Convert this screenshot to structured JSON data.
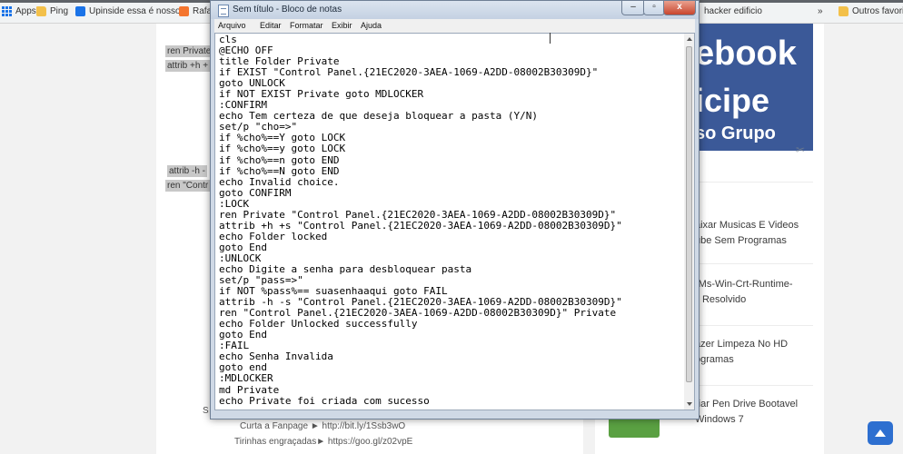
{
  "bookmarks_bar": {
    "items": [
      {
        "label": "Apps"
      },
      {
        "label": "Ping"
      },
      {
        "label": "Upinside essa é nosso"
      },
      {
        "label": "Rafa"
      },
      {
        "label": "hacker edificio"
      },
      {
        "label": "Outros favorit"
      }
    ],
    "more_label": "»"
  },
  "article": {
    "snippets": [
      "ren Private",
      "attrib +h +",
      "attrib -h -",
      "ren \"Contr"
    ],
    "bottom_links": [
      {
        "text": "Curta a Fanpage ► http://bit.ly/1Ssb3wO"
      },
      {
        "text": "Tirinhas engraçadas► https://goo.gl/z02vpE"
      }
    ],
    "left_fragment": "S"
  },
  "sidebar": {
    "banner": {
      "line1": "ebook",
      "line2": "icipe",
      "line3": "so Grupo"
    },
    "posts": [
      {
        "line1": "aixar Musicas E Videos",
        "line2": "ube Sem Programas"
      },
      {
        "line1": "-Ms-Win-Crt-Runtime-",
        "line2": "ll Resolvido"
      },
      {
        "line1": "azer Limpeza No HD",
        "line2": "ogramas"
      },
      {
        "line1": "riar Pen Drive Bootavel",
        "line2": "Windows 7"
      }
    ]
  },
  "notepad": {
    "title": "Sem título - Bloco de notas",
    "window_buttons": {
      "minimize": "–",
      "maximize": "▫",
      "close": "x"
    },
    "menu": [
      "Arquivo",
      "Editar",
      "Formatar",
      "Exibir",
      "Ajuda"
    ],
    "content": "cls\n@ECHO OFF\ntitle Folder Private\nif EXIST \"Control Panel.{21EC2020-3AEA-1069-A2DD-08002B30309D}\"\ngoto UNLOCK\nif NOT EXIST Private goto MDLOCKER\n:CONFIRM\necho Tem certeza de que deseja bloquear a pasta (Y/N)\nset/p \"cho=>\"\nif %cho%==Y goto LOCK\nif %cho%==y goto LOCK\nif %cho%==n goto END\nif %cho%==N goto END\necho Invalid choice.\ngoto CONFIRM\n:LOCK\nren Private \"Control Panel.{21EC2020-3AEA-1069-A2DD-08002B30309D}\"\nattrib +h +s \"Control Panel.{21EC2020-3AEA-1069-A2DD-08002B30309D}\"\necho Folder locked\ngoto End\n:UNLOCK\necho Digite a senha para desbloquear pasta\nset/p \"pass=>\"\nif NOT %pass%== suasenhaaqui goto FAIL\nattrib -h -s \"Control Panel.{21EC2020-3AEA-1069-A2DD-08002B30309D}\"\nren \"Control Panel.{21EC2020-3AEA-1069-A2DD-08002B30309D}\" Private\necho Folder Unlocked successfully\ngoto End\n:FAIL\necho Senha Invalida\ngoto end\n:MDLOCKER\nmd Private\necho Private foi criada com sucesso"
  }
}
